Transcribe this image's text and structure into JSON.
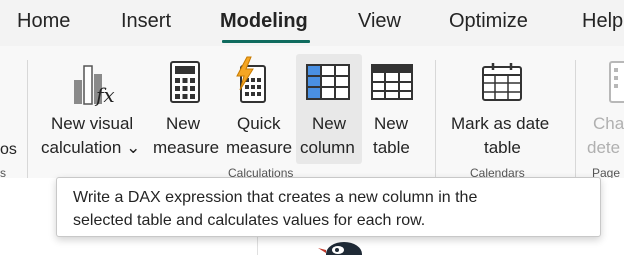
{
  "tabs": [
    {
      "label": "Home"
    },
    {
      "label": "Insert"
    },
    {
      "label": "Modeling"
    },
    {
      "label": "View"
    },
    {
      "label": "Optimize"
    },
    {
      "label": "Help"
    }
  ],
  "active_tab": "Modeling",
  "ribbon": {
    "left_partial_text": [
      "os",
      "s"
    ],
    "new_visual_calculation": {
      "line1": "New visual",
      "line2": "calculation"
    },
    "new_measure": {
      "line1": "New",
      "line2": "measure"
    },
    "quick_measure": {
      "line1": "Quick",
      "line2": "measure"
    },
    "new_column": {
      "line1": "New",
      "line2": "column"
    },
    "new_table": {
      "line1": "New",
      "line2": "table"
    },
    "mark_as_date_table": {
      "line1": "Mark as date",
      "line2": "table"
    },
    "change_detect": {
      "line1": "Cha",
      "line2": "dete"
    },
    "group_calculations": "Calculations",
    "group_calendars": "Calendars",
    "group_page_refresh": "Page re"
  },
  "tooltip": {
    "line1": "Write a DAX expression that creates a new column in the",
    "line2": "selected table and calculates values for each row."
  },
  "colors": {
    "accent": "#0f6b5e",
    "column_highlight": "#4a90e2",
    "quick_measure_bolt": "#f5a623"
  }
}
